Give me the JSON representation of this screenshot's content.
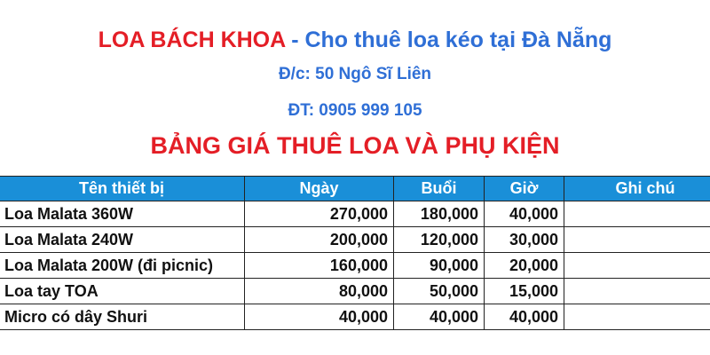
{
  "header": {
    "brand": "LOA BÁCH KHOA",
    "separator": " - ",
    "tagline": "Cho thuê loa kéo tại Đà Nẵng",
    "address": "Đ/c: 50 Ngô Sĩ Liên",
    "phone": "ĐT: 0905 999 105",
    "table_title": "BẢNG GIÁ THUÊ LOA VÀ PHỤ KIỆN"
  },
  "colors": {
    "brand_red": "#e41e26",
    "info_blue": "#2f6fd6",
    "header_bg": "#1a8fd8"
  },
  "table": {
    "columns": [
      "Tên thiết bị",
      "Ngày",
      "Buổi",
      "Giờ",
      "Ghi chú"
    ],
    "rows": [
      [
        "Loa Malata 360W",
        "270,000",
        "180,000",
        "40,000",
        ""
      ],
      [
        "Loa Malata 240W",
        "200,000",
        "120,000",
        "30,000",
        ""
      ],
      [
        "Loa Malata 200W (đi picnic)",
        "160,000",
        "90,000",
        "20,000",
        ""
      ],
      [
        "Loa tay TOA",
        "80,000",
        "50,000",
        "15,000",
        ""
      ],
      [
        "Micro có dây Shuri",
        "40,000",
        "40,000",
        "40,000",
        ""
      ]
    ]
  }
}
